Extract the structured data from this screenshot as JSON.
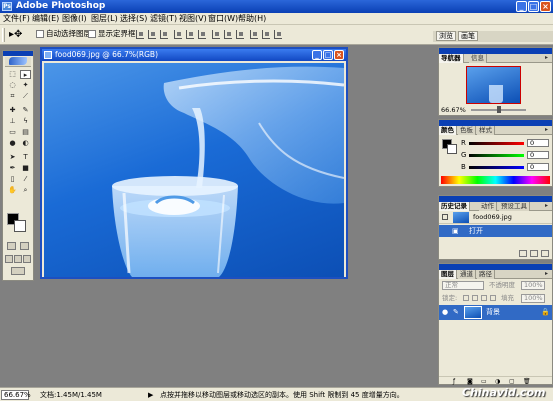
{
  "app": {
    "title": "Adobe Photoshop",
    "icon_name": "photoshop-icon"
  },
  "menu": [
    "文件(F)",
    "编辑(E)",
    "图像(I)",
    "图层(L)",
    "选择(S)",
    "滤镜(T)",
    "视图(V)",
    "窗口(W)",
    "帮助(H)"
  ],
  "options": {
    "auto_select_layer": "自动选择图层",
    "show_bounds": "显示定界框",
    "right_tabs": [
      "浏览",
      "画笔"
    ]
  },
  "document": {
    "title": "food069.jpg @ 66.7%(RGB)"
  },
  "navigator": {
    "tabs": [
      "导航器",
      "信息"
    ],
    "zoom": "66.67%"
  },
  "color_panel": {
    "tabs": [
      "颜色",
      "色板",
      "样式"
    ],
    "channels": [
      {
        "label": "R",
        "value": "0"
      },
      {
        "label": "G",
        "value": "0"
      },
      {
        "label": "B",
        "value": "0"
      }
    ]
  },
  "history": {
    "tabs": [
      "历史记录",
      "动作",
      "预设工具"
    ],
    "snapshot": "food069.jpg",
    "items": [
      "打开"
    ]
  },
  "layers": {
    "tabs": [
      "图层",
      "通道",
      "路径"
    ],
    "blend_mode": "正常",
    "opacity_label": "不透明度",
    "opacity": "100%",
    "lock_label": "锁定:",
    "fill_label": "填充",
    "fill": "100%",
    "layer_name": "背景"
  },
  "status": {
    "zoom": "66.67%",
    "doc_info": "文档:1.45M/1.45M",
    "hint": "点按并拖移以移动图层或移动选区的副本。使用 Shift 限制到 45 度增量方向。"
  },
  "watermark": "Chinavid.com",
  "colors": {
    "titlebar": "#0a3fb4",
    "chrome": "#ece9d8",
    "workspace": "#808080",
    "selection": "#316ac5"
  }
}
